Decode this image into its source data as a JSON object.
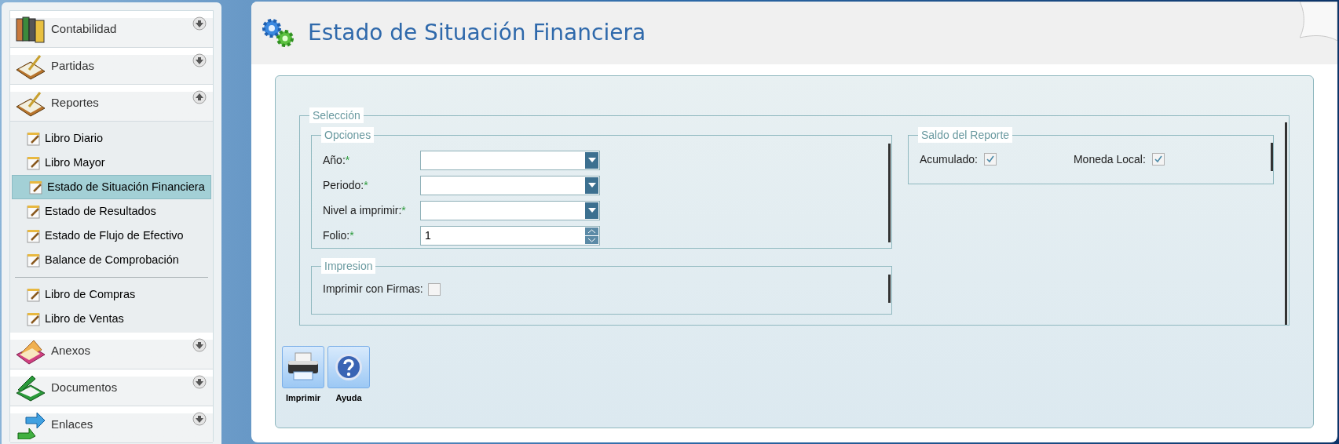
{
  "sidebar": {
    "sections": [
      {
        "label": "Contabilidad",
        "expanded": false
      },
      {
        "label": "Partidas",
        "expanded": false
      },
      {
        "label": "Reportes",
        "expanded": true,
        "groups": [
          {
            "items": [
              {
                "label": "Libro Diario",
                "selected": false
              },
              {
                "label": "Libro Mayor",
                "selected": false
              },
              {
                "label": "Estado de Situación Financiera",
                "selected": true
              },
              {
                "label": "Estado de Resultados",
                "selected": false
              },
              {
                "label": "Estado de Flujo de Efectivo",
                "selected": false
              },
              {
                "label": "Balance de Comprobación",
                "selected": false
              }
            ]
          },
          {
            "items": [
              {
                "label": "Libro de Compras",
                "selected": false
              },
              {
                "label": "Libro de Ventas",
                "selected": false
              }
            ]
          }
        ]
      },
      {
        "label": "Anexos",
        "expanded": false
      },
      {
        "label": "Documentos",
        "expanded": false
      },
      {
        "label": "Enlaces",
        "expanded": false
      }
    ]
  },
  "page": {
    "title": "Estado de Situación Financiera"
  },
  "form": {
    "legend": "Selección",
    "options": {
      "legend": "Opciones",
      "fields": [
        {
          "label": "Año:",
          "required_mark": "*",
          "kind": "select"
        },
        {
          "label": "Periodo:",
          "required_mark": "*",
          "kind": "select"
        },
        {
          "label": "Nivel a imprimir:",
          "required_mark": "*",
          "kind": "select"
        },
        {
          "label": "Folio:",
          "required_mark": "*",
          "kind": "spinner",
          "value": "1"
        }
      ]
    },
    "printing": {
      "legend": "Impresion",
      "checks": [
        {
          "label": "Imprimir con Firmas:",
          "checked": false
        }
      ]
    },
    "balance": {
      "legend": "Saldo del Reporte",
      "checks": [
        {
          "label": "Acumulado:",
          "checked": true
        },
        {
          "label": "Moneda Local:",
          "checked": true
        }
      ]
    }
  },
  "toolbar": [
    {
      "label": "Imprimir",
      "kind": "print"
    },
    {
      "label": "Ayuda",
      "kind": "help"
    }
  ]
}
